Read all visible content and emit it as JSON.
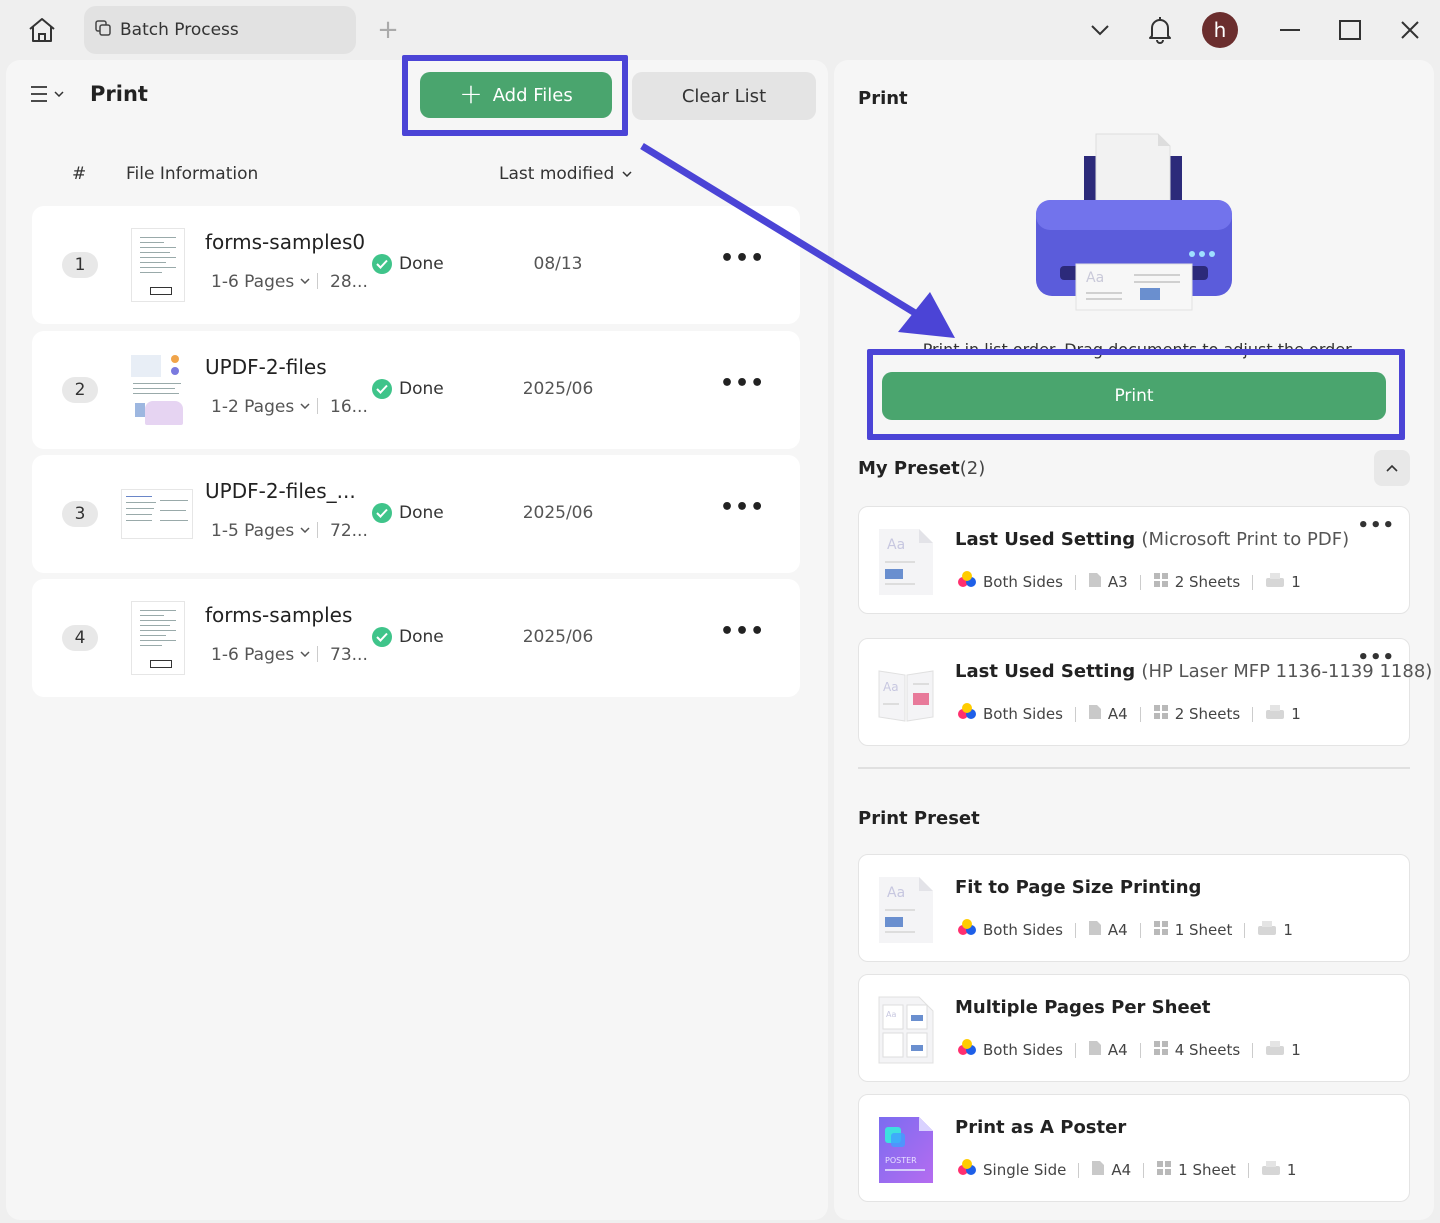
{
  "tab": {
    "title": "Batch Process",
    "icon": "copy-icon"
  },
  "avatar": {
    "letter": "h"
  },
  "left": {
    "title": "Print",
    "add_files_label": "Add Files",
    "clear_list_label": "Clear List",
    "columns": {
      "num": "#",
      "info": "File Information",
      "modified": "Last modified"
    },
    "files": [
      {
        "num": "1",
        "name": "forms-samples0",
        "pages": "1-6 Pages",
        "size": "28...",
        "status": "Done",
        "date": "08/13"
      },
      {
        "num": "2",
        "name": "UPDF-2-files",
        "pages": "1-2 Pages",
        "size": "16...",
        "status": "Done",
        "date": "2025/06"
      },
      {
        "num": "3",
        "name": "UPDF-2-files_...",
        "pages": "1-5 Pages",
        "size": "72...",
        "status": "Done",
        "date": "2025/06"
      },
      {
        "num": "4",
        "name": "forms-samples",
        "pages": "1-6 Pages",
        "size": "73...",
        "status": "Done",
        "date": "2025/06"
      }
    ]
  },
  "right": {
    "title": "Print",
    "hint": "Print in list order. Drag documents to adjust the order.",
    "print_label": "Print",
    "my_preset": {
      "title": "My Preset",
      "count": "(2)"
    },
    "my_presets": [
      {
        "name": "Last Used Setting",
        "sub": "(Microsoft Print to PDF)",
        "sides": "Both Sides",
        "paper": "A3",
        "sheets": "2 Sheets",
        "copies": "1"
      },
      {
        "name": "Last Used Setting",
        "sub": "(HP Laser MFP 1136-1139 1188)",
        "sides": "Both Sides",
        "paper": "A4",
        "sheets": "2 Sheets",
        "copies": "1"
      }
    ],
    "print_preset_title": "Print Preset",
    "print_presets": [
      {
        "name": "Fit to Page Size Printing",
        "sides": "Both Sides",
        "paper": "A4",
        "sheets": "1 Sheet",
        "copies": "1"
      },
      {
        "name": "Multiple Pages Per Sheet",
        "sides": "Both Sides",
        "paper": "A4",
        "sheets": "4 Sheets",
        "copies": "1"
      },
      {
        "name": "Print as A Poster",
        "sides": "Single Side",
        "paper": "A4",
        "sheets": "1 Sheet",
        "copies": "1"
      }
    ]
  },
  "colors": {
    "accent_green": "#4aa56e",
    "highlight": "#4b44d6",
    "done": "#3fc48a"
  }
}
